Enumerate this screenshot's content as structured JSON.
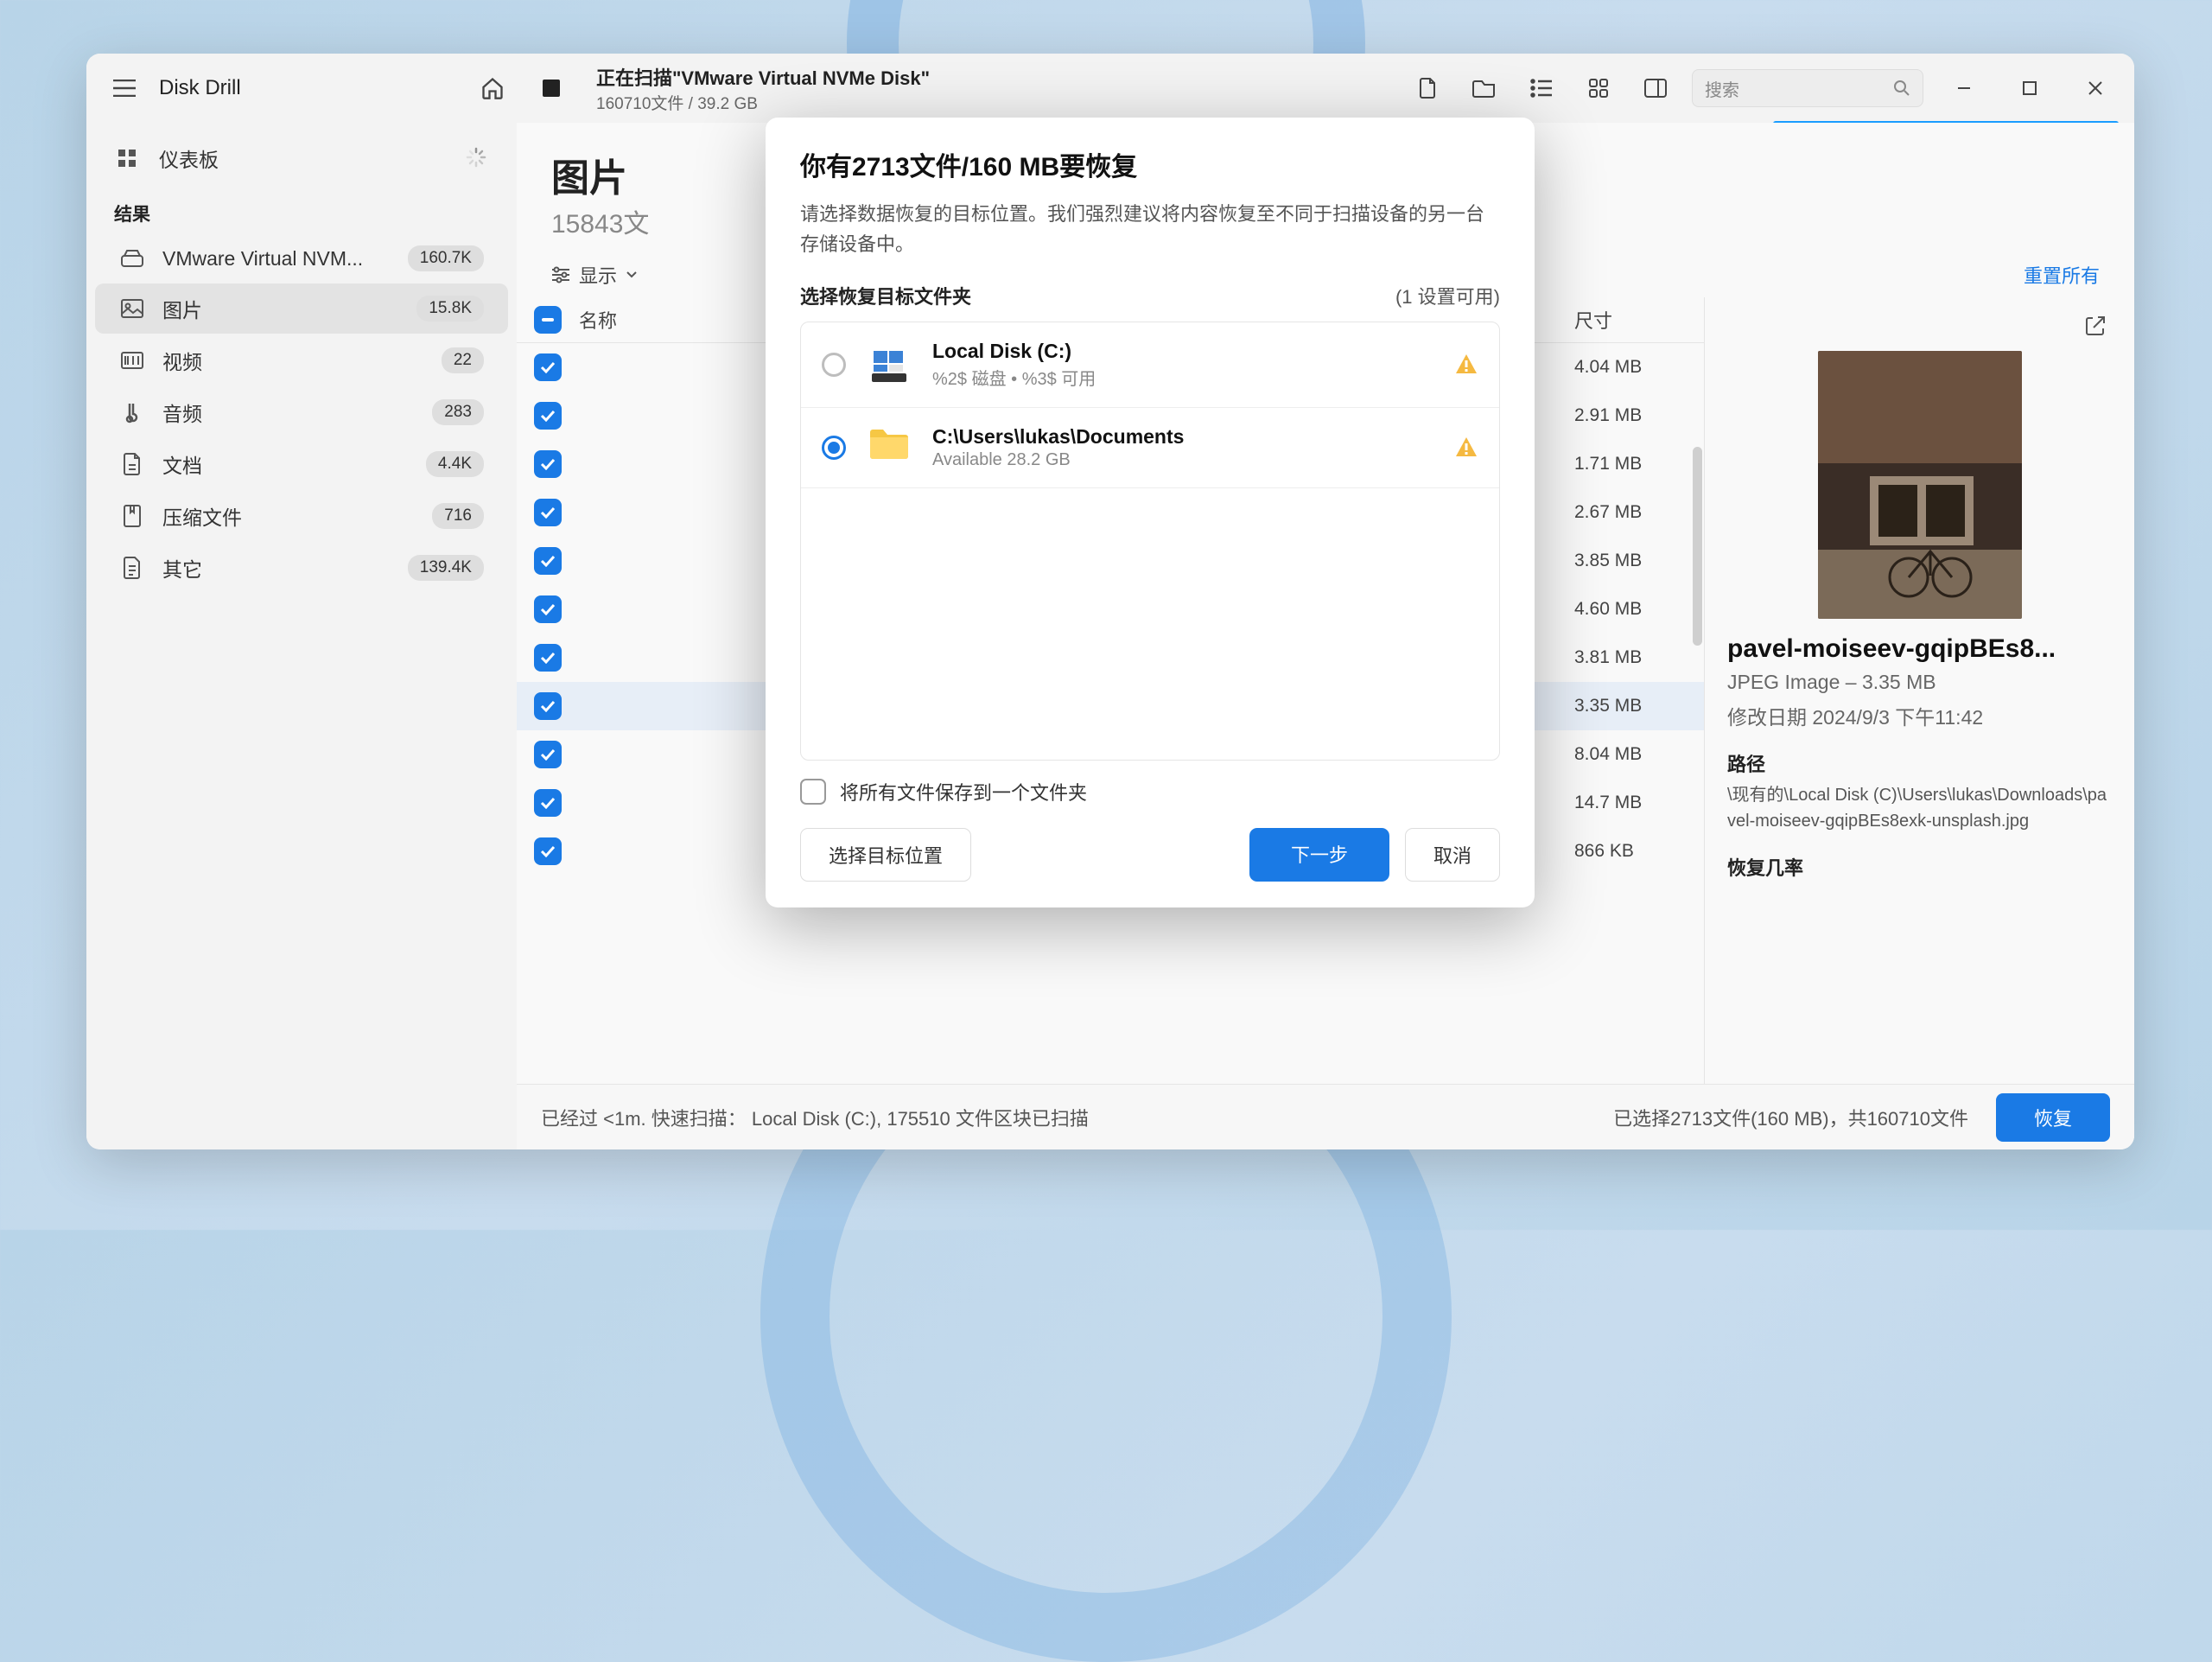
{
  "app": {
    "title": "Disk Drill"
  },
  "titlebar": {
    "scan_title": "正在扫描\"VMware Virtual NVMe Disk\"",
    "scan_sub": "160710文件 / 39.2 GB",
    "search_placeholder": "搜索"
  },
  "sidebar": {
    "dashboard": "仪表板",
    "section_results": "结果",
    "items": [
      {
        "label": "VMware Virtual NVM...",
        "badge": "160.7K"
      },
      {
        "label": "图片",
        "badge": "15.8K"
      },
      {
        "label": "视频",
        "badge": "22"
      },
      {
        "label": "音频",
        "badge": "283"
      },
      {
        "label": "文档",
        "badge": "4.4K"
      },
      {
        "label": "压缩文件",
        "badge": "716"
      },
      {
        "label": "其它",
        "badge": "139.4K"
      }
    ]
  },
  "content": {
    "title": "图片",
    "subtitle": "15843文",
    "filter_label": "显示",
    "reset": "重置所有",
    "th_name": "名称",
    "th_size": "尺寸",
    "rows": [
      {
        "size": "4.04 MB"
      },
      {
        "size": "2.91 MB"
      },
      {
        "size": "1.71 MB"
      },
      {
        "size": "2.67 MB"
      },
      {
        "size": "3.85 MB"
      },
      {
        "size": "4.60 MB"
      },
      {
        "size": "3.81 MB"
      },
      {
        "size": "3.35 MB",
        "sel": true
      },
      {
        "size": "8.04 MB"
      },
      {
        "size": "14.7 MB"
      },
      {
        "size": "866 KB"
      }
    ]
  },
  "preview": {
    "name": "pavel-moiseev-gqipBEs8...",
    "type_size": "JPEG Image – 3.35 MB",
    "mod_label_value": "修改日期 2024/9/3 下午11:42",
    "path_label": "路径",
    "path_value": "\\现有的\\Local Disk (C)\\Users\\lukas\\Downloads\\pavel-moiseev-gqipBEs8exk-unsplash.jpg",
    "chance_label": "恢复几率"
  },
  "footer": {
    "elapsed": "已经过 <1m. 快速扫描： Local Disk (C:), 175510 文件区块已扫描",
    "selected": "已选择2713文件(160 MB)，共160710文件",
    "recover": "恢复"
  },
  "modal": {
    "title": "你有2713文件/160 MB要恢复",
    "desc": "请选择数据恢复的目标位置。我们强烈建议将内容恢复至不同于扫描设备的另一台存储设备中。",
    "dest_header": "选择恢复目标文件夹",
    "dest_hint": "(1 设置可用)",
    "dests": [
      {
        "name": "Local Disk (C:)",
        "sub": "%2$ 磁盘 • %3$ 可用",
        "selected": false,
        "type": "disk"
      },
      {
        "name": "C:\\Users\\lukas\\Documents",
        "sub": "Available 28.2 GB",
        "selected": true,
        "type": "folder"
      }
    ],
    "save_one": "将所有文件保存到一个文件夹",
    "choose_btn": "选择目标位置",
    "next_btn": "下一步",
    "cancel_btn": "取消"
  }
}
